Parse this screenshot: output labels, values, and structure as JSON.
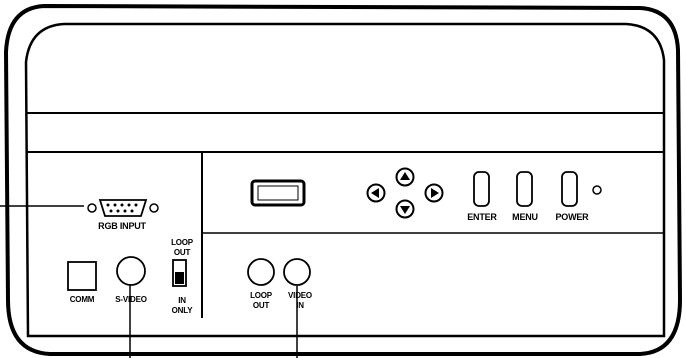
{
  "labels": {
    "rgb_input": "RGB INPUT",
    "loop_out_switch_top": "LOOP",
    "loop_out_switch_bottom": "OUT",
    "in_only_top": "IN",
    "in_only_bottom": "ONLY",
    "comm": "COMM",
    "s_video": "S-VIDEO",
    "loop_out_jack_top": "LOOP",
    "loop_out_jack_bottom": "OUT",
    "video_in_top": "VIDEO",
    "video_in_bottom": "IN",
    "enter": "ENTER",
    "menu": "MENU",
    "power": "POWER"
  }
}
